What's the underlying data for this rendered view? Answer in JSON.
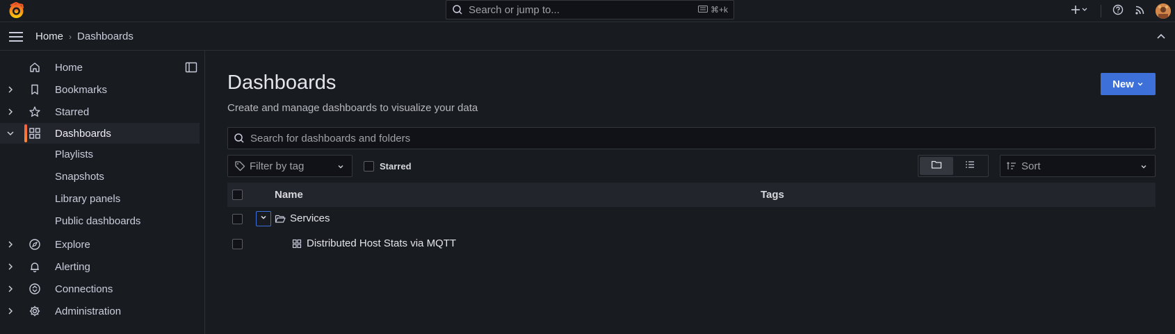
{
  "topbar": {
    "search_placeholder": "Search or jump to...",
    "search_shortcut": "⌘+k"
  },
  "breadcrumb": {
    "home": "Home",
    "separator": "›",
    "current": "Dashboards"
  },
  "sidebar": {
    "items": [
      {
        "label": "Home",
        "icon": "home-icon",
        "expandable": false
      },
      {
        "label": "Bookmarks",
        "icon": "bookmark-icon",
        "expandable": true
      },
      {
        "label": "Starred",
        "icon": "star-icon",
        "expandable": true
      },
      {
        "label": "Dashboards",
        "icon": "apps-icon",
        "expandable": true,
        "active": true
      },
      {
        "label": "Explore",
        "icon": "compass-icon",
        "expandable": true
      },
      {
        "label": "Alerting",
        "icon": "bell-icon",
        "expandable": true
      },
      {
        "label": "Connections",
        "icon": "connections-icon",
        "expandable": true
      },
      {
        "label": "Administration",
        "icon": "cog-icon",
        "expandable": true
      }
    ],
    "sub_items": [
      "Playlists",
      "Snapshots",
      "Library panels",
      "Public dashboards"
    ]
  },
  "main": {
    "title": "Dashboards",
    "subtitle": "Create and manage dashboards to visualize your data",
    "new_button": "New",
    "search_placeholder": "Search for dashboards and folders",
    "tag_filter_placeholder": "Filter by tag",
    "starred_label": "Starred",
    "sort_placeholder": "Sort",
    "columns": {
      "name": "Name",
      "tags": "Tags"
    },
    "rows": [
      {
        "type": "folder",
        "name": "Services",
        "expanded": true
      },
      {
        "type": "dashboard",
        "name": "Distributed Host Stats via MQTT"
      }
    ]
  },
  "colors": {
    "accent": "#3d71d9",
    "active_bar": "#f55f3e",
    "background": "#181b1f"
  }
}
